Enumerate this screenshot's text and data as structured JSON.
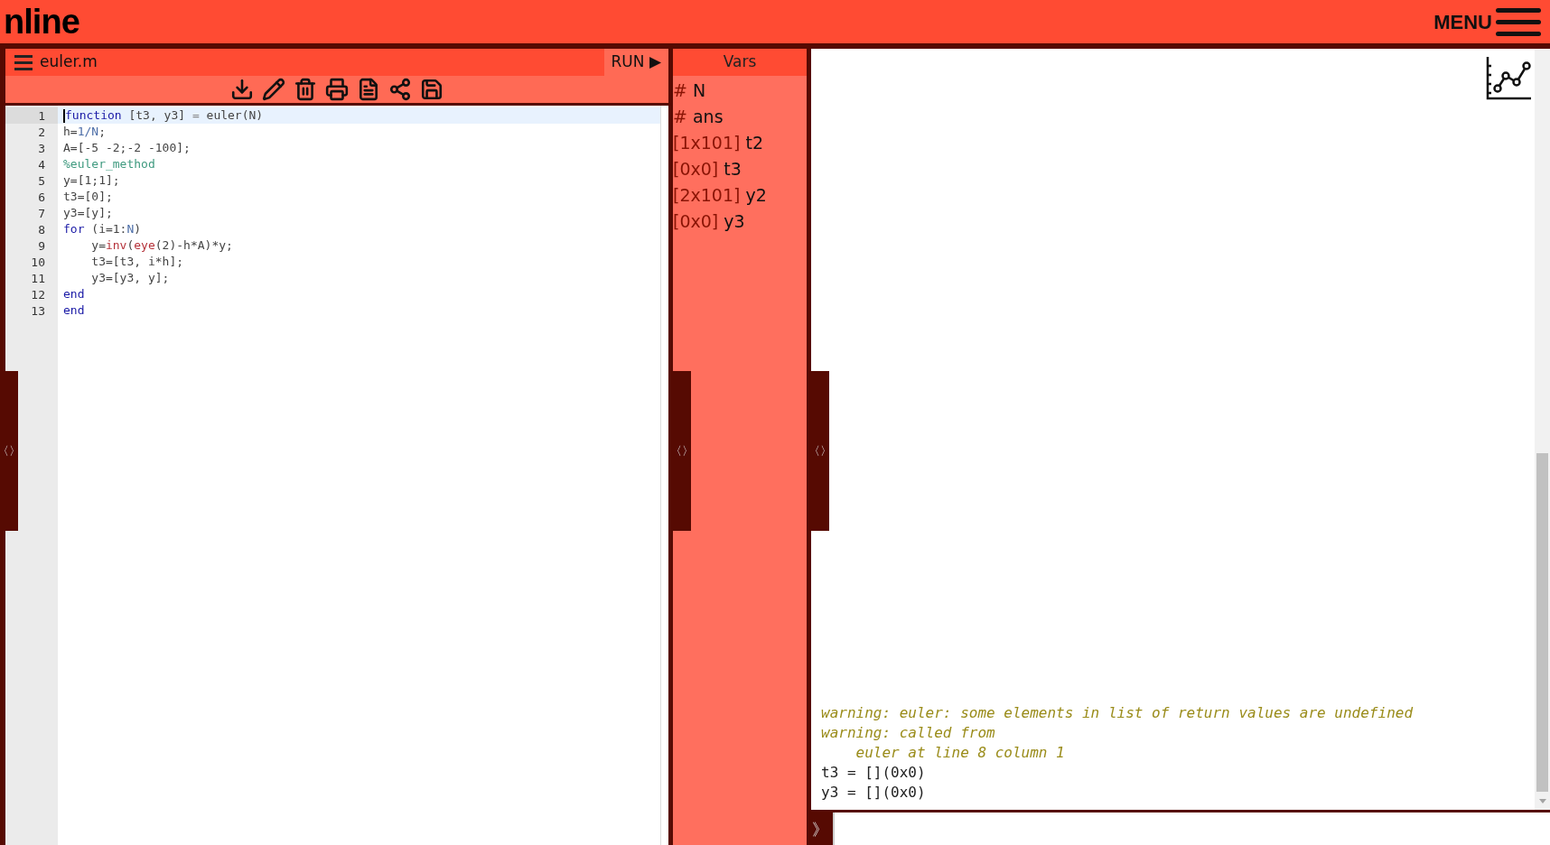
{
  "header": {
    "logo": "nline",
    "menu_label": "MENU"
  },
  "editor": {
    "file_name": "euler.m",
    "run_label": "RUN",
    "run_glyph": "▶",
    "handle": "〈〉",
    "lines": [
      {
        "number": "1",
        "active": true,
        "tokens": [
          {
            "kind": "keyword",
            "text": "function"
          },
          {
            "kind": "text",
            "text": " [t3, y3] "
          },
          {
            "kind": "op",
            "text": "="
          },
          {
            "kind": "text",
            "text": " euler(N)"
          }
        ]
      },
      {
        "number": "2",
        "active": false,
        "tokens": [
          {
            "kind": "text",
            "text": "h="
          },
          {
            "kind": "var",
            "text": "1/N"
          },
          {
            "kind": "text",
            "text": ";"
          }
        ]
      },
      {
        "number": "3",
        "active": false,
        "tokens": [
          {
            "kind": "text",
            "text": "A=[-5 -2;-2 -100];"
          }
        ]
      },
      {
        "number": "4",
        "active": false,
        "tokens": [
          {
            "kind": "comment",
            "text": "%euler_method"
          }
        ]
      },
      {
        "number": "5",
        "active": false,
        "tokens": [
          {
            "kind": "text",
            "text": "y=[1;1];"
          }
        ]
      },
      {
        "number": "6",
        "active": false,
        "tokens": [
          {
            "kind": "text",
            "text": "t3=[0];"
          }
        ]
      },
      {
        "number": "7",
        "active": false,
        "tokens": [
          {
            "kind": "text",
            "text": "y3=[y];"
          }
        ]
      },
      {
        "number": "8",
        "active": false,
        "tokens": [
          {
            "kind": "keyword",
            "text": "for"
          },
          {
            "kind": "text",
            "text": " (i=1:"
          },
          {
            "kind": "var",
            "text": "N"
          },
          {
            "kind": "text",
            "text": ")"
          }
        ]
      },
      {
        "number": "9",
        "active": false,
        "tokens": [
          {
            "kind": "text",
            "text": "    y="
          },
          {
            "kind": "builtin",
            "text": "inv"
          },
          {
            "kind": "text",
            "text": "("
          },
          {
            "kind": "builtin",
            "text": "eye"
          },
          {
            "kind": "text",
            "text": "(2)-h*A)*y;"
          }
        ]
      },
      {
        "number": "10",
        "active": false,
        "tokens": [
          {
            "kind": "text",
            "text": "    t3=[t3, i*h];"
          }
        ]
      },
      {
        "number": "11",
        "active": false,
        "tokens": [
          {
            "kind": "text",
            "text": "    y3=[y3, y];"
          }
        ]
      },
      {
        "number": "12",
        "active": false,
        "tokens": [
          {
            "kind": "keyword",
            "text": "end"
          }
        ]
      },
      {
        "number": "13",
        "active": false,
        "tokens": [
          {
            "kind": "keyword",
            "text": "end"
          }
        ]
      }
    ]
  },
  "vars": {
    "title": "Vars",
    "handle": "〈〉",
    "items": [
      {
        "prefix": "#",
        "name": "N"
      },
      {
        "prefix": "#",
        "name": "ans"
      },
      {
        "prefix": "[1x101]",
        "name": "t2"
      },
      {
        "prefix": "[0x0]",
        "name": "t3"
      },
      {
        "prefix": "[2x101]",
        "name": "y2"
      },
      {
        "prefix": "[0x0]",
        "name": "y3"
      }
    ]
  },
  "console": {
    "handle": "〈〉",
    "prompt": "》",
    "lines": [
      {
        "kind": "warning",
        "text": "warning: euler: some elements in list of return values are undefined"
      },
      {
        "kind": "warning",
        "text": "warning: called from"
      },
      {
        "kind": "warning",
        "text": "    euler at line 8 column 1"
      },
      {
        "kind": "output",
        "text": "t3 = [](0x0)"
      },
      {
        "kind": "output",
        "text": "y3 = [](0x0)"
      }
    ]
  }
}
